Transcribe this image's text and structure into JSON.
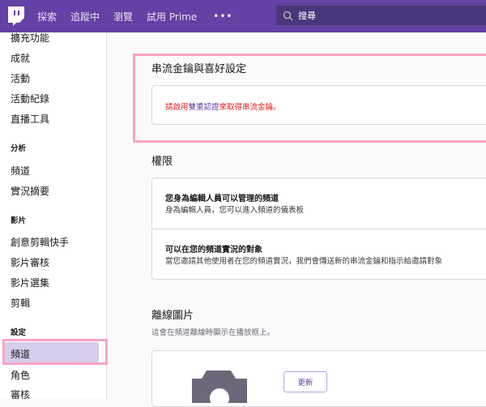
{
  "nav": {
    "links": [
      "探索",
      "追蹤中",
      "瀏覽",
      "試用 Prime"
    ],
    "more": "•••",
    "search_placeholder": "搜尋"
  },
  "sidebar": {
    "items_top": [
      "擴充功能",
      "成就",
      "活動",
      "活動紀錄",
      "直播工具"
    ],
    "section_analytics": "分析",
    "analytics_items": [
      "頻道",
      "實況摘要"
    ],
    "section_video": "影片",
    "video_items": [
      "創意剪輯快手",
      "影片審核",
      "影片選集",
      "剪輯"
    ],
    "section_settings": "設定",
    "settings_items": [
      "頻道",
      "角色",
      "審核"
    ]
  },
  "stream_key": {
    "title": "串流金鑰與喜好設定",
    "msg_pre": "請啟用",
    "msg_link": "雙重認證",
    "msg_post": "來取得串流金鑰。"
  },
  "permissions": {
    "title": "權限",
    "rows": [
      {
        "title": "您身為編輯人員可以管理的頻道",
        "desc": "身為編輯人員，您可以進入頻道的儀表板"
      },
      {
        "title": "可以在您的頻道實況的對象",
        "desc": "當您邀請其他使用者在您的頻道實況，我們會傳送新的串流金鑰和指示給邀請對象"
      }
    ]
  },
  "offline": {
    "title": "離線圖片",
    "desc": "這會在頻道離線時顯示在播放框上。",
    "update_button": "更新"
  }
}
